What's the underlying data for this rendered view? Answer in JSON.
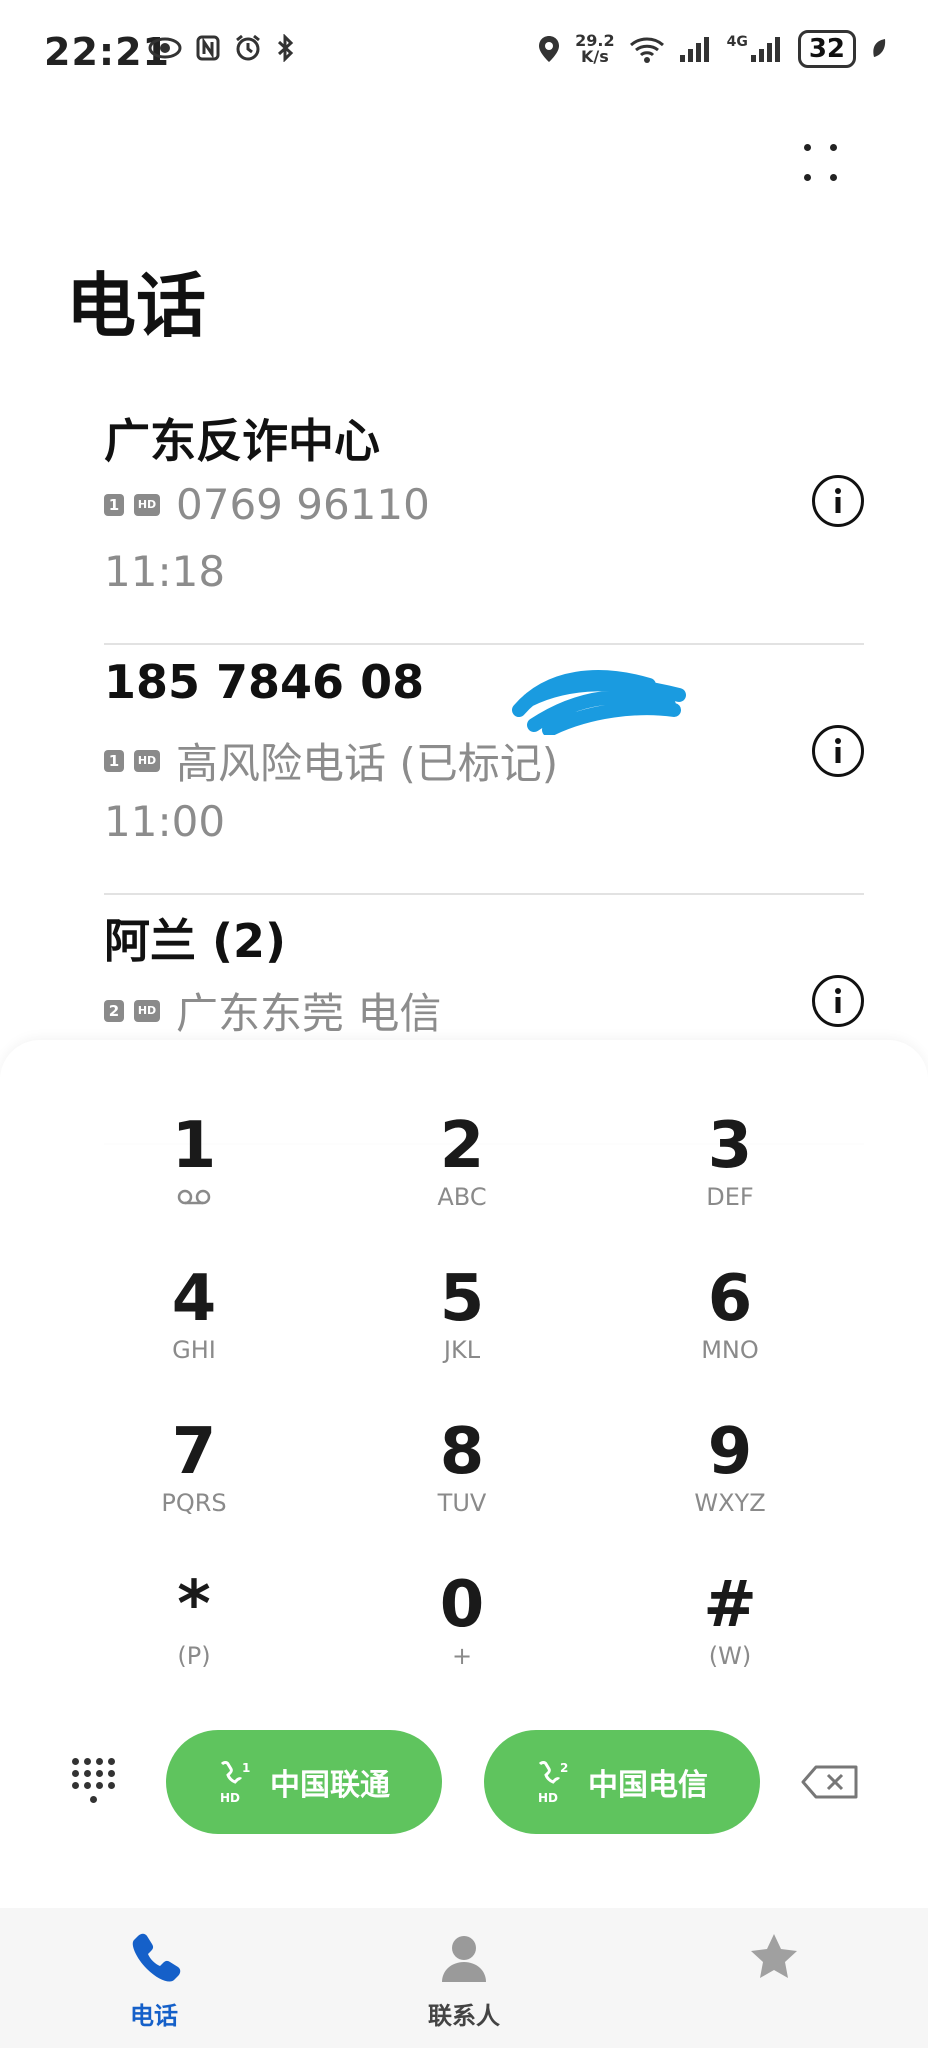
{
  "status_bar": {
    "time": "22:21",
    "net_speed_value": "29.2",
    "net_speed_unit": "K/s",
    "network": "4G",
    "battery": "32"
  },
  "page_title": "电话",
  "calls": [
    {
      "name": "广东反诈中心",
      "sim": "1",
      "hd": "HD",
      "detail": "0769 96110",
      "time": "11:18"
    },
    {
      "name": "185 7846 08",
      "sim": "1",
      "hd": "HD",
      "detail": "高风险电话 (已标记)",
      "time": "11:00"
    },
    {
      "name": "阿兰 (2)",
      "sim": "2",
      "hd": "HD",
      "detail": "广东东莞 电信",
      "time": ""
    }
  ],
  "dialpad": {
    "keys": [
      {
        "digit": "1",
        "letters": ""
      },
      {
        "digit": "2",
        "letters": "ABC"
      },
      {
        "digit": "3",
        "letters": "DEF"
      },
      {
        "digit": "4",
        "letters": "GHI"
      },
      {
        "digit": "5",
        "letters": "JKL"
      },
      {
        "digit": "6",
        "letters": "MNO"
      },
      {
        "digit": "7",
        "letters": "PQRS"
      },
      {
        "digit": "8",
        "letters": "TUV"
      },
      {
        "digit": "9",
        "letters": "WXYZ"
      },
      {
        "digit": "*",
        "letters": "(P)"
      },
      {
        "digit": "0",
        "letters": "+"
      },
      {
        "digit": "#",
        "letters": "(W)"
      }
    ],
    "sim1_label": "中国联通",
    "sim1_num": "1",
    "sim2_label": "中国电信",
    "sim2_num": "2",
    "hd": "HD"
  },
  "nav": {
    "phone": "电话",
    "contacts": "联系人"
  },
  "colors": {
    "accent": "#1560c9",
    "call_button": "#5fc45e",
    "scribble": "#1a9be0"
  }
}
